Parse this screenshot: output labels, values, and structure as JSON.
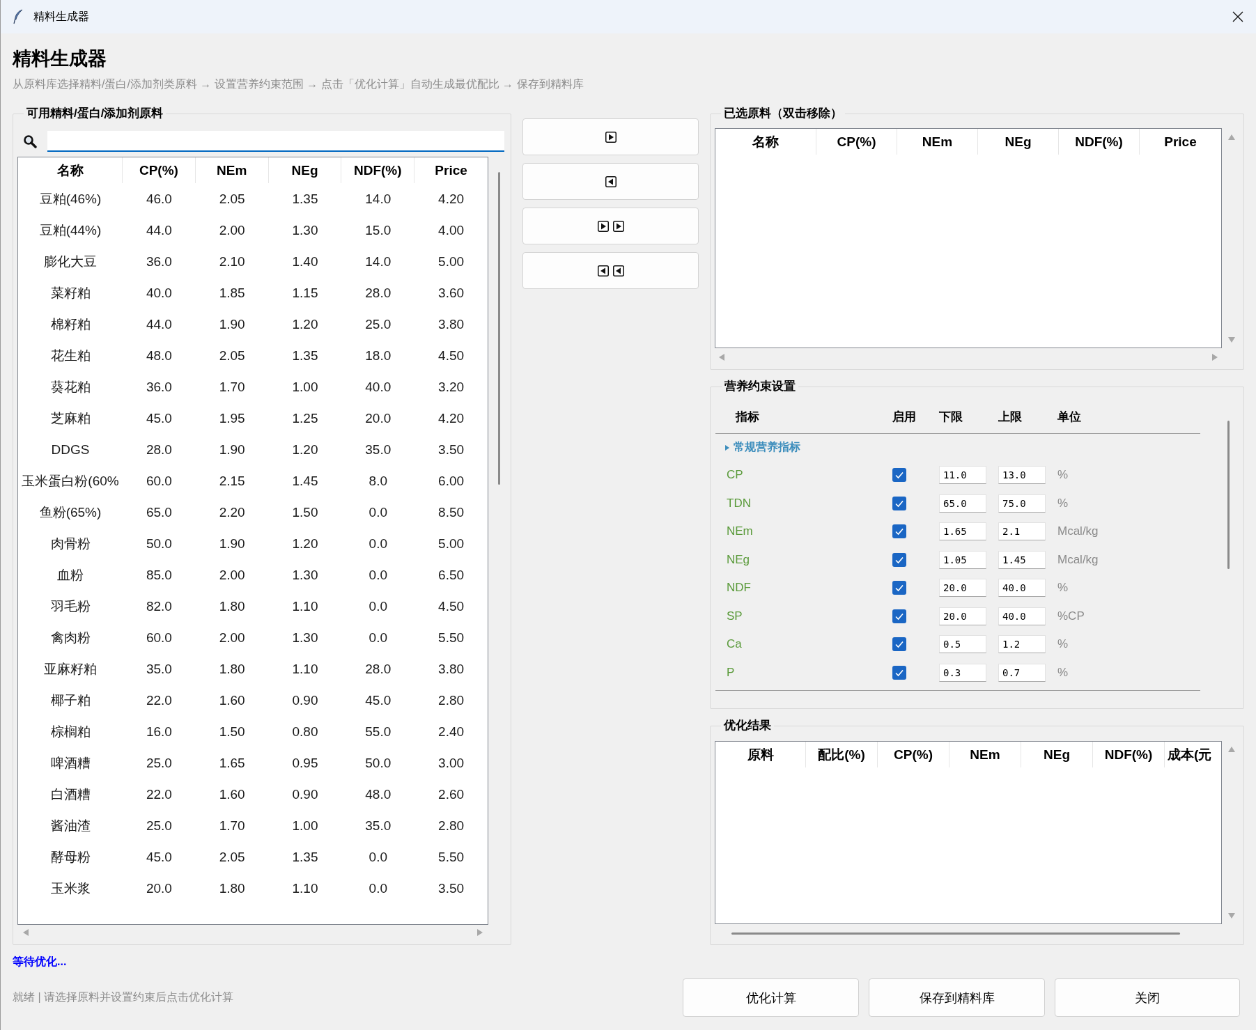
{
  "window": {
    "title": "精料生成器"
  },
  "header": {
    "title": "精料生成器",
    "subtitle": "从原料库选择精料/蛋白/添加剂类原料 → 设置营养约束范围 → 点击「优化计算」自动生成最优配比 → 保存到精料库"
  },
  "available": {
    "title": "可用精料/蛋白/添加剂原料",
    "search": {
      "focused": true
    },
    "table": {
      "columns": [
        "名称",
        "CP(%)",
        "NEm",
        "NEg",
        "NDF(%)",
        "Price"
      ],
      "rows": [
        [
          "豆粕(46%)",
          "46.0",
          "2.05",
          "1.35",
          "14.0",
          "4.20"
        ],
        [
          "豆粕(44%)",
          "44.0",
          "2.00",
          "1.30",
          "15.0",
          "4.00"
        ],
        [
          "膨化大豆",
          "36.0",
          "2.10",
          "1.40",
          "14.0",
          "5.00"
        ],
        [
          "菜籽粕",
          "40.0",
          "1.85",
          "1.15",
          "28.0",
          "3.60"
        ],
        [
          "棉籽粕",
          "44.0",
          "1.90",
          "1.20",
          "25.0",
          "3.80"
        ],
        [
          "花生粕",
          "48.0",
          "2.05",
          "1.35",
          "18.0",
          "4.50"
        ],
        [
          "葵花粕",
          "36.0",
          "1.70",
          "1.00",
          "40.0",
          "3.20"
        ],
        [
          "芝麻粕",
          "45.0",
          "1.95",
          "1.25",
          "20.0",
          "4.20"
        ],
        [
          "DDGS",
          "28.0",
          "1.90",
          "1.20",
          "35.0",
          "3.50"
        ],
        [
          "玉米蛋白粉(60%",
          "60.0",
          "2.15",
          "1.45",
          "8.0",
          "6.00"
        ],
        [
          "鱼粉(65%)",
          "65.0",
          "2.20",
          "1.50",
          "0.0",
          "8.50"
        ],
        [
          "肉骨粉",
          "50.0",
          "1.90",
          "1.20",
          "0.0",
          "5.00"
        ],
        [
          "血粉",
          "85.0",
          "2.00",
          "1.30",
          "0.0",
          "6.50"
        ],
        [
          "羽毛粉",
          "82.0",
          "1.80",
          "1.10",
          "0.0",
          "4.50"
        ],
        [
          "禽肉粉",
          "60.0",
          "2.00",
          "1.30",
          "0.0",
          "5.50"
        ],
        [
          "亚麻籽粕",
          "35.0",
          "1.80",
          "1.10",
          "28.0",
          "3.80"
        ],
        [
          "椰子粕",
          "22.0",
          "1.60",
          "0.90",
          "45.0",
          "2.80"
        ],
        [
          "棕榈粕",
          "16.0",
          "1.50",
          "0.80",
          "55.0",
          "2.40"
        ],
        [
          "啤酒糟",
          "25.0",
          "1.65",
          "0.95",
          "50.0",
          "3.00"
        ],
        [
          "白酒糟",
          "22.0",
          "1.60",
          "0.90",
          "48.0",
          "2.60"
        ],
        [
          "酱油渣",
          "25.0",
          "1.70",
          "1.00",
          "35.0",
          "2.80"
        ],
        [
          "酵母粉",
          "45.0",
          "2.05",
          "1.35",
          "0.0",
          "5.50"
        ],
        [
          "玉米浆",
          "20.0",
          "1.80",
          "1.10",
          "0.0",
          "3.50"
        ]
      ]
    }
  },
  "transfer_buttons": [
    {
      "kind": "add"
    },
    {
      "kind": "remove"
    },
    {
      "kind": "add_all"
    },
    {
      "kind": "remove_all"
    }
  ],
  "selected": {
    "title": "已选原料（双击移除）",
    "table": {
      "columns": [
        "名称",
        "CP(%)",
        "NEm",
        "NEg",
        "NDF(%)",
        "Price"
      ]
    }
  },
  "constraints": {
    "title": "营养约束设置",
    "columns": [
      "指标",
      "启用",
      "下限",
      "上限",
      "单位"
    ],
    "groups": [
      {
        "label": "常规营养指标",
        "children": [
          {
            "name": "CP",
            "enabled": true,
            "min": "11.0",
            "max": "13.0",
            "unit": "%"
          },
          {
            "name": "TDN",
            "enabled": true,
            "min": "65.0",
            "max": "75.0",
            "unit": "%"
          },
          {
            "name": "NEm",
            "enabled": true,
            "min": "1.65",
            "max": "2.1",
            "unit": "Mcal/kg"
          },
          {
            "name": "NEg",
            "enabled": true,
            "min": "1.05",
            "max": "1.45",
            "unit": "Mcal/kg"
          },
          {
            "name": "NDF",
            "enabled": true,
            "min": "20.0",
            "max": "40.0",
            "unit": "%"
          },
          {
            "name": "SP",
            "enabled": true,
            "min": "20.0",
            "max": "40.0",
            "unit": "%CP"
          },
          {
            "name": "Ca",
            "enabled": true,
            "min": "0.5",
            "max": "1.2",
            "unit": "%"
          },
          {
            "name": "P",
            "enabled": true,
            "min": "0.3",
            "max": "0.7",
            "unit": "%"
          }
        ]
      }
    ]
  },
  "results": {
    "title": "优化结果",
    "table": {
      "columns": [
        "原料",
        "配比(%)",
        "CP(%)",
        "NEm",
        "NEg",
        "NDF(%)",
        "成本(元"
      ]
    }
  },
  "status": {
    "message": "等待优化...",
    "hint": "就绪 | 请选择原料并设置约束后点击优化计算"
  },
  "buttons": [
    "优化计算",
    "保存到精料库",
    "关闭"
  ]
}
